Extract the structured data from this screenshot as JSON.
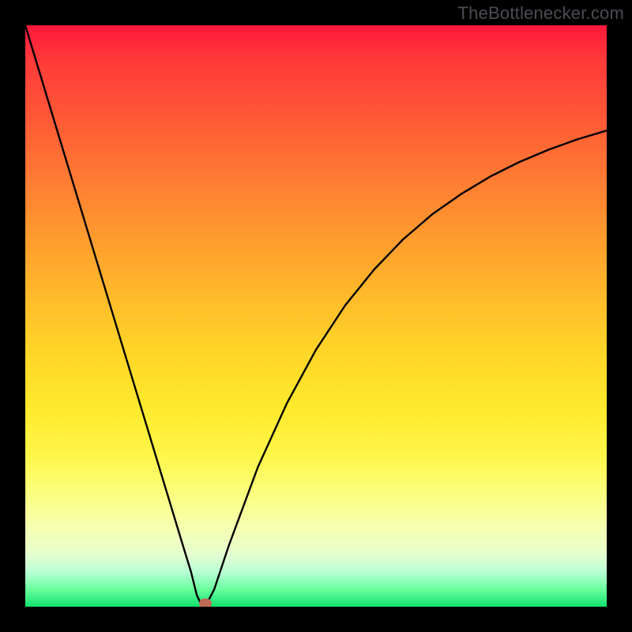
{
  "watermark": "TheBottlenecker.com",
  "chart_data": {
    "type": "line",
    "title": "",
    "xlabel": "",
    "ylabel": "",
    "xlim": [
      0,
      100
    ],
    "ylim": [
      0,
      100
    ],
    "grid": false,
    "legend": false,
    "series": [
      {
        "name": "bottleneck-curve",
        "x": [
          0,
          4,
          8,
          12,
          16,
          20,
          23,
          25,
          27,
          28.5,
          29.5,
          30.2,
          31.2,
          32.5,
          35,
          40,
          45,
          50,
          55,
          60,
          65,
          70,
          75,
          80,
          85,
          90,
          95,
          100
        ],
        "y": [
          100,
          86.8,
          73.6,
          60.4,
          47.2,
          34.0,
          24.1,
          17.5,
          10.9,
          6.0,
          2.0,
          0.5,
          0.5,
          3.0,
          10.5,
          24.0,
          35.0,
          44.2,
          51.8,
          58.0,
          63.2,
          67.5,
          71.0,
          74.0,
          76.5,
          78.6,
          80.4,
          81.9
        ]
      }
    ],
    "marker": {
      "name": "optimal-point",
      "x": 31,
      "y": 0.5
    },
    "background_gradient": {
      "top": "#ff173a",
      "mid": "#ffea2d",
      "bottom": "#11e06b"
    }
  }
}
